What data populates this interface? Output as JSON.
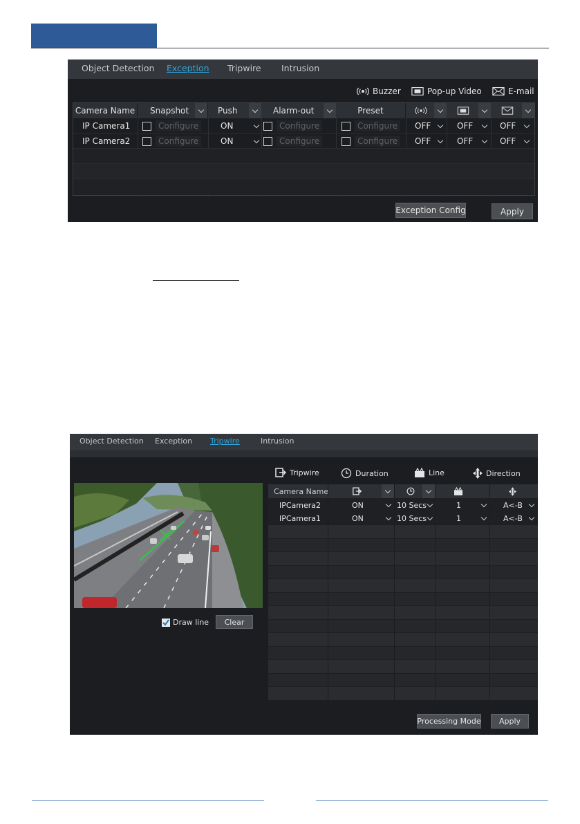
{
  "panel1": {
    "tabs": [
      "Object Detection",
      "Exception",
      "Tripwire",
      "Intrusion"
    ],
    "active_tab": "Exception",
    "toolbar": {
      "buzzer": "Buzzer",
      "popup_video": "Pop-up Video",
      "email": "E-mail"
    },
    "columns": {
      "camera_name": "Camera Name",
      "snapshot": "Snapshot",
      "push": "Push",
      "alarm_out": "Alarm-out",
      "preset": "Preset"
    },
    "configure_label": "Configure",
    "rows": [
      {
        "camera": "IP Camera1",
        "push": "ON",
        "buzzer": "OFF",
        "popup": "OFF",
        "email": "OFF"
      },
      {
        "camera": "IP Camera2",
        "push": "ON",
        "buzzer": "OFF",
        "popup": "OFF",
        "email": "OFF"
      }
    ],
    "buttons": {
      "exception_config": "Exception Config",
      "apply": "Apply"
    }
  },
  "panel2": {
    "tabs": [
      "Object Detection",
      "Exception",
      "Tripwire",
      "Intrusion"
    ],
    "active_tab": "Tripwire",
    "legend": {
      "tripwire": "Tripwire",
      "duration": "Duration",
      "line": "Line",
      "direction": "Direction"
    },
    "columns": {
      "camera_name": "Camera Name"
    },
    "rows": [
      {
        "camera": "IPCamera2",
        "tripwire": "ON",
        "duration": "10 Secs",
        "line": "1",
        "direction": "A<-B"
      },
      {
        "camera": "IPCamera1",
        "tripwire": "ON",
        "duration": "10 Secs",
        "line": "1",
        "direction": "A<-B"
      }
    ],
    "draw_line": "Draw line",
    "draw_line_checked": true,
    "buttons": {
      "clear": "Clear",
      "processing_mode": "Processing Mode",
      "apply": "Apply"
    }
  },
  "colors": {
    "accent": "#2fa6e0",
    "header_block": "#2e5a97",
    "panel_bg": "#1b1d20"
  }
}
